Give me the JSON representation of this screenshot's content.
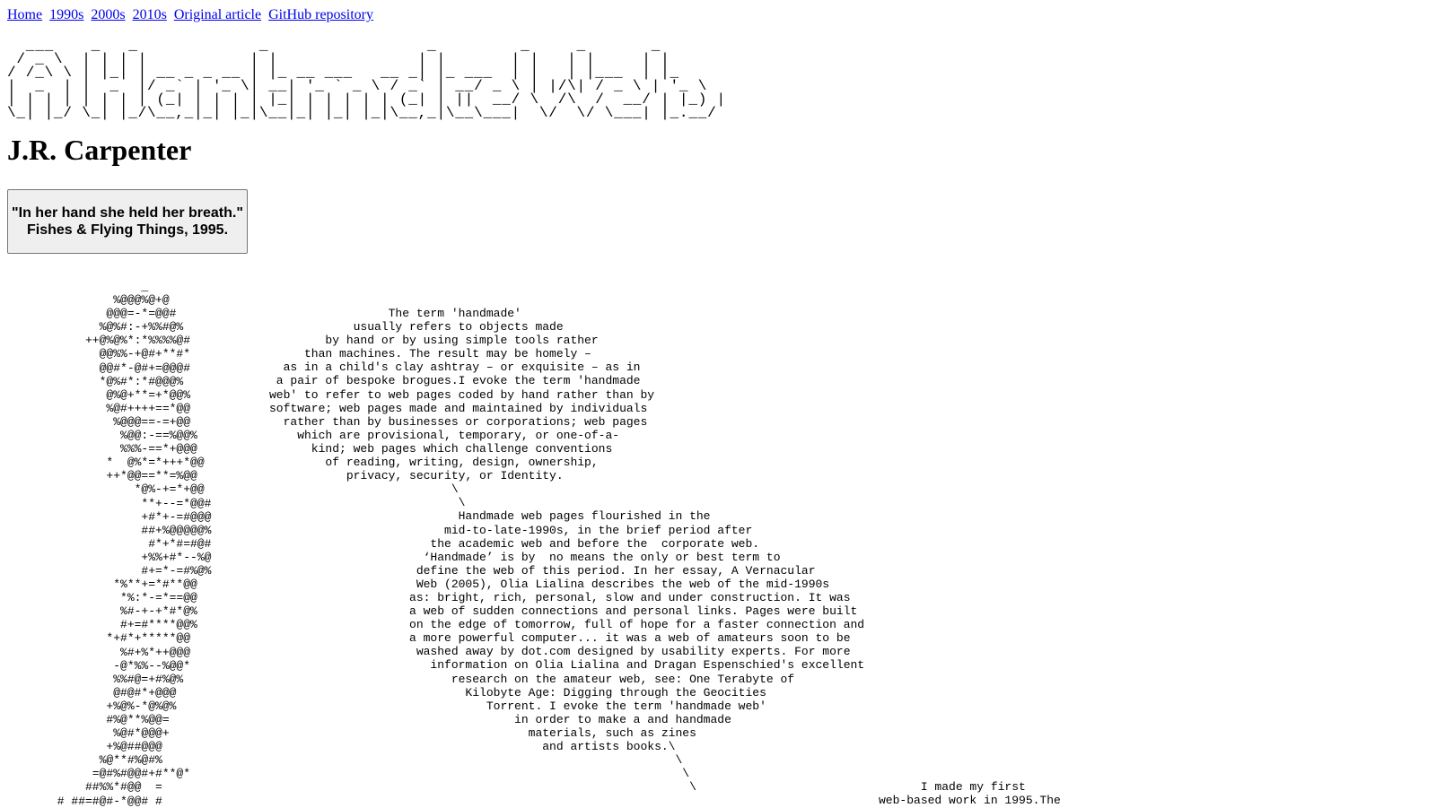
{
  "nav": {
    "links": [
      "Home",
      "1990s",
      "2000s",
      "2010s",
      "Original article",
      "GitHub repository"
    ]
  },
  "banner_ascii": "  ___    _   _             _                 _         _     _       _  \n / _ \\  | | | |           | |               | |       | |   | |     | | \n/ /_\\ \\ | |_| | __ _ _ __ | |_ __ ___   __ _| |_ ___  | |   | |___  | |_ \n|  _  | |  _  |/ _` | '_ \\| __| '_ ` _ \\ / _` | __/ _ \\ | |/\\| / _ \\ | '_ \\\n| | | | | | | | (_| | | | | |_| | | | | | (_| | ||  __/ \\  /\\  /  __/ | |_) |\n\\_| |_/ \\_| |_/\\__,_|_| |_|\\__|_| |_| |_|\\__,_|\\__\\___|  \\/  \\/ \\___| |_.__/",
  "author": "J.R. Carpenter",
  "quote_button": {
    "line1": "\"In her hand she held her breath.\"",
    "line2": "Fishes & Flying Things, 1995."
  },
  "hand_ascii": "             _\n         %@@@%@+@\n        @@@=-*=@@#\n       %@%#:-+%%#@%\n     ++@%@%*:*%%%%@#\n       @@%%-+@#+**#*\n       @@#*-@#+=@@@#\n       *@%#*:*#@@@%\n        @%@+**=+*@@%\n        %@#++++==*@@\n         %@@@==-=+@@\n          %@@:-==%@@%\n          %%%-==*+@@@\n        *  @%*=*+++*@@\n        ++*@@==**=%@@\n            *@%-+=*+@@\n             **+--=*@@#\n             +#*+-=#@@@\n             ##+%@@@@@%\n              #*+*#=#@#\n             +%%+#*--%@\n             #+=*-=#%@%\n         *%**+=*#**@@\n          *%:*-=*==@@\n          %#-+-+*#*@%\n          #+=#****@@%\n        *+#*+*****@@\n          %#+%*++@@@\n         -@*%%--%@@*\n         %%#@=+#%@%\n         @#@#*+@@@\n        +%@%-*@%@%\n        #%@**%@@=\n         %@#*@@@+\n        +%@##@@@\n       %@**#%@#%\n      =@#%#@@#+#**@*\n     ##%%*#@@  =\n # ##=#@#-*@@# #",
  "essay_ascii": "                 The term 'handmade'\n            usually refers to objects made\n        by hand or by using simple tools rather\n     than machines. The result may be homely –\n  as in a child's clay ashtray – or exquisite – as in\n a pair of bespoke brogues.I evoke the term 'handmade\nweb' to refer to web pages coded by hand rather than by\nsoftware; web pages made and maintained by individuals\n  rather than by businesses or corporations; web pages\n    which are provisional, temporary, or one-of-a-\n      kind; web pages which challenge conventions\n        of reading, writing, design, ownership,\n           privacy, security, or Identity.\n                          \\\n                           \\\n                           Handmade web pages flourished in the\n                         mid-to-late-1990s, in the brief period after\n                       the academic web and before the  corporate web.\n                      ‘Handmade’ is by  no means the only or best term to\n                     define the web of this period. In her essay, A Vernacular\n                     Web (2005), Olia Lialina describes the web of the mid-1990s\n                    as: bright, rich, personal, slow and under construction. It was\n                    a web of sudden connections and personal links. Pages were built\n                    on the edge of tomorrow, full of hope for a faster connection and\n                    a more powerful computer... it was a web of amateurs soon to be\n                     washed away by dot.com designed by usability experts. For more\n                       information on Olia Lialina and Dragan Espenschied's excellent\n                          research on the amateur web, see: One Terabyte of\n                            Kilobyte Age: Digging through the Geocities\n                               Torrent. I evoke the term 'handmade web'\n                                   in order to make a and handmade\n                                     materials, such as zines\n                                       and artists books.\\\n                                                          \\\n                                                           \\\n                                                            \\",
  "essay2_ascii": "           I made my first\n     web-based work in 1995.The"
}
